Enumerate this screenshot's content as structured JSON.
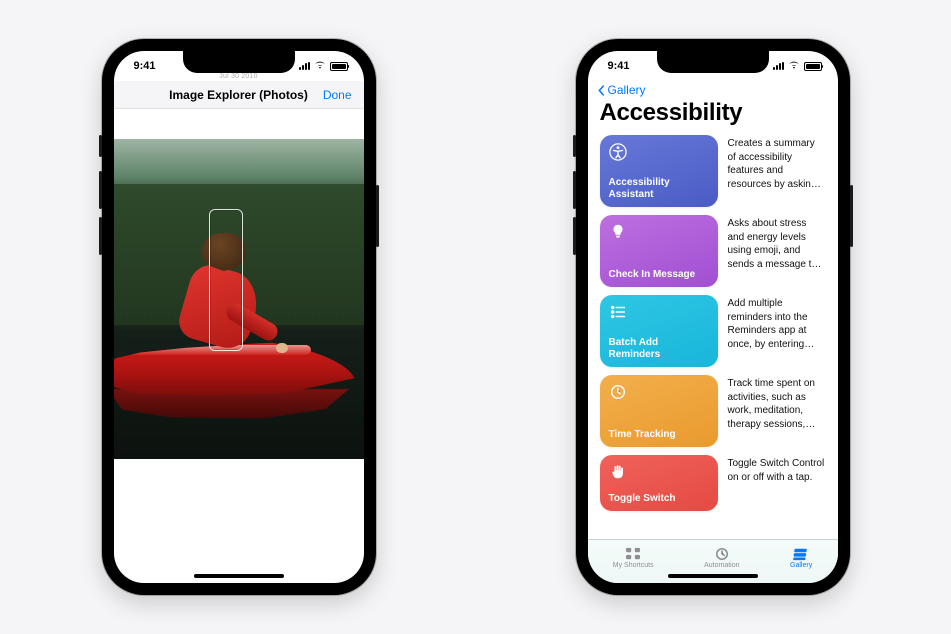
{
  "status": {
    "time": "9:41"
  },
  "phone1": {
    "faint_date": "Jul 30 2010",
    "title": "Image Explorer (Photos)",
    "done": "Done"
  },
  "phone2": {
    "back_label": "Gallery",
    "heading": "Accessibility",
    "items": [
      {
        "title": "Accessibility Assistant",
        "desc": "Creates a summary of accessibility features and resources by askin…"
      },
      {
        "title": "Check In Message",
        "desc": "Asks about stress and energy levels using emoji, and sends a message t…"
      },
      {
        "title": "Batch Add Reminders",
        "desc": "Add multiple reminders into the Reminders app at once, by entering…"
      },
      {
        "title": "Time Tracking",
        "desc": "Track time spent on activities, such as work, meditation, therapy sessions,…"
      },
      {
        "title": "Toggle Switch",
        "desc": "Toggle Switch Control on or off with a tap."
      }
    ],
    "tabs": {
      "shortcuts": "My Shortcuts",
      "automation": "Automation",
      "gallery": "Gallery"
    }
  }
}
